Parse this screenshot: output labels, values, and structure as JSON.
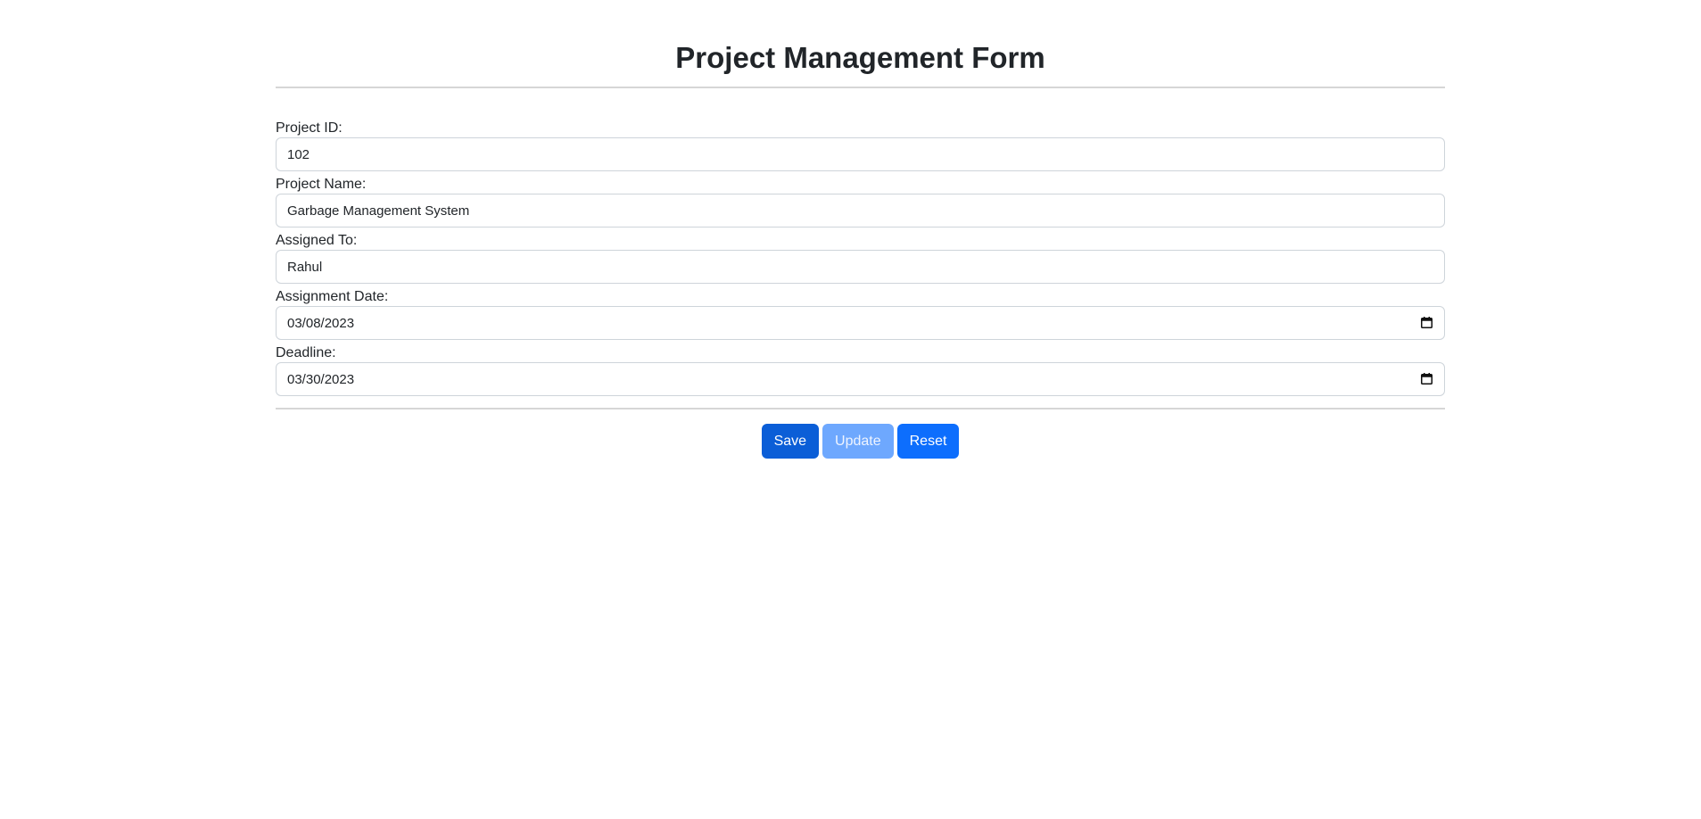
{
  "page": {
    "title": "Project Management Form"
  },
  "form": {
    "project_id": {
      "label": "Project ID:",
      "value": "102"
    },
    "project_name": {
      "label": "Project Name:",
      "value": "Garbage Management System"
    },
    "assigned_to": {
      "label": "Assigned To:",
      "value": "Rahul"
    },
    "assignment_date": {
      "label": "Assignment Date:",
      "value": "03/08/2023",
      "icon": "calendar-icon"
    },
    "deadline": {
      "label": "Deadline:",
      "value": "03/30/2023",
      "icon": "calendar-icon"
    }
  },
  "buttons": {
    "save": "Save",
    "update": "Update",
    "reset": "Reset"
  },
  "colors": {
    "save": "#0b5ed7",
    "update": "#6ea8fe",
    "reset": "#0d6efd",
    "input_border": "#ced4da",
    "rule": "#d6d6d6"
  }
}
